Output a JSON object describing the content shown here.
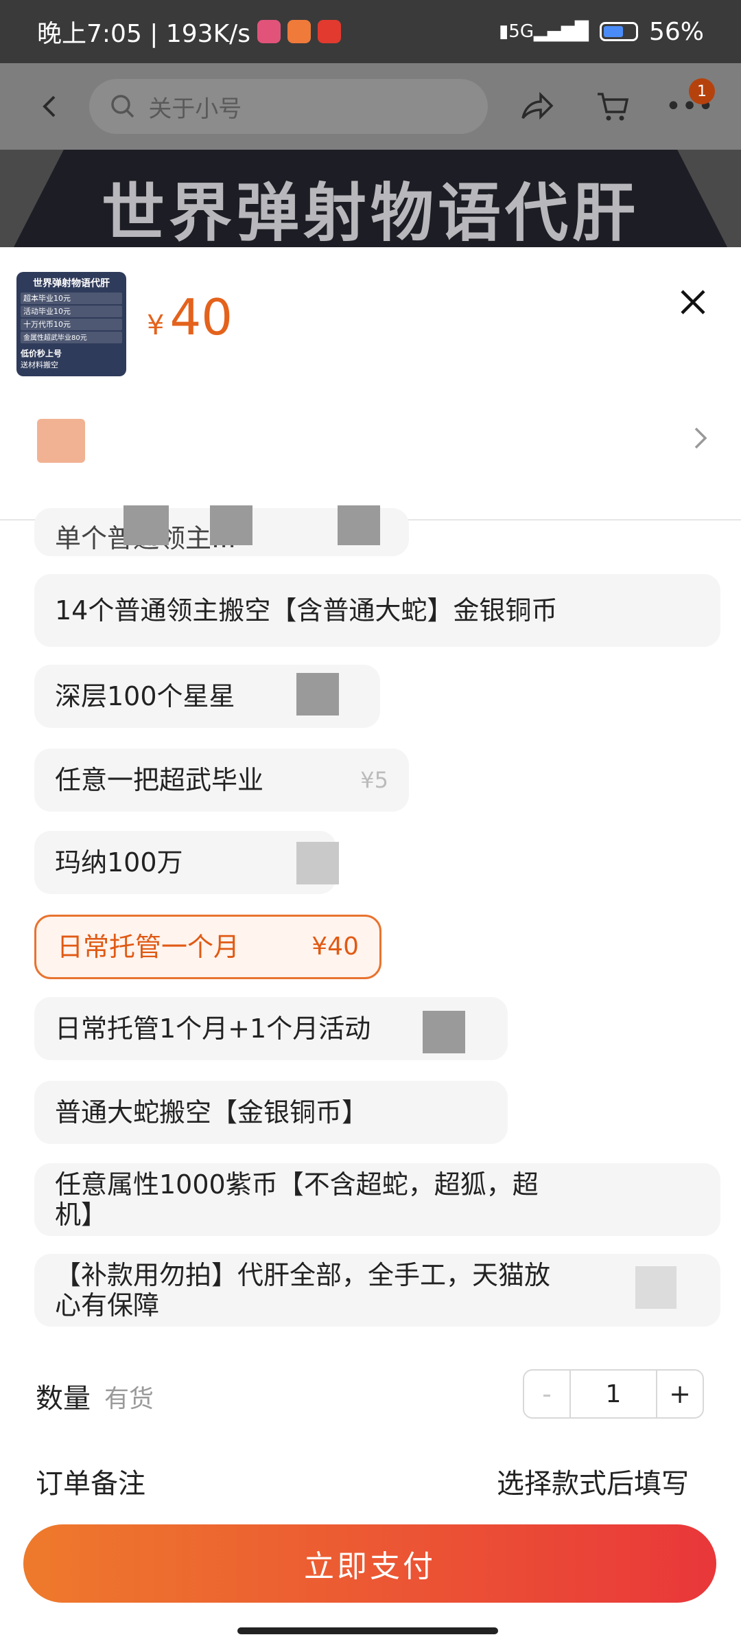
{
  "status_bar": {
    "time": "晚上7:05 | 193K/s",
    "network": "5G",
    "battery": "56%"
  },
  "header": {
    "search_placeholder": "关于小号",
    "cart_badge": "1"
  },
  "banner": {
    "title": "世界弹射物语代肝"
  },
  "sheet": {
    "currency": "¥",
    "price": "40",
    "thumb_title": "世界弹射物语代肝",
    "thumb_lines": [
      "超本毕业10元",
      "活动毕业10元",
      "十万代币10元",
      "金属性超武毕业80元",
      "低价秒上号",
      "送材料搬空"
    ]
  },
  "options": [
    {
      "label": "单个普通领主...",
      "price": ""
    },
    {
      "label": "14个普通领主搬空【含普通大蛇】金银铜币",
      "price": ""
    },
    {
      "label": "深层100个星星",
      "price": ""
    },
    {
      "label": "任意一把超武毕业",
      "price": "¥5"
    },
    {
      "label": "玛纳100万",
      "price": ""
    },
    {
      "label": "日常托管一个月",
      "price": "¥40",
      "selected": true
    },
    {
      "label": "日常托管1个月+1个月活动",
      "price": ""
    },
    {
      "label": "普通大蛇搬空【金银铜币】",
      "price": ""
    },
    {
      "label": "任意属性1000紫币【不含超蛇，超狐，超机】",
      "price": ""
    },
    {
      "label": "【补款用勿拍】代肝全部，全手工，天猫放心有保障",
      "price": ""
    }
  ],
  "quantity": {
    "label": "数量",
    "stock": "有货",
    "minus": "-",
    "value": "1",
    "plus": "+"
  },
  "order_note": {
    "label": "订单备注",
    "hint": "选择款式后填写"
  },
  "pay_button": "立即支付",
  "colors": {
    "accent": "#e4621c",
    "pay_start": "#ee7a2c",
    "pay_end": "#e9373a"
  }
}
